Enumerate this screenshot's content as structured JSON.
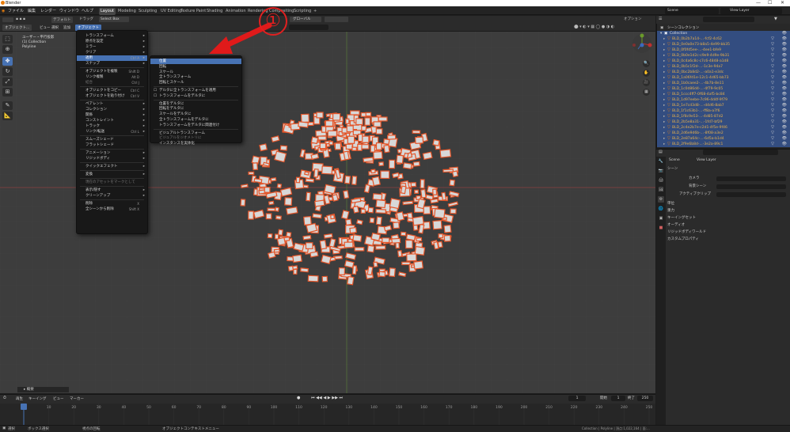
{
  "window": {
    "title": "Blender",
    "controls": [
      "—",
      "☐",
      "✕"
    ]
  },
  "menubar": {
    "menus": [
      "ファイル",
      "編集",
      "レンダー",
      "ウィンドウ",
      "ヘルプ"
    ],
    "workspaces": [
      "Layout",
      "Modeling",
      "Sculpting",
      "UV Editing",
      "Texture Paint",
      "Shading",
      "Animation",
      "Rendering",
      "Compositing",
      "Scripting",
      "+"
    ],
    "active_workspace": "Layout",
    "scene_label": "Scene",
    "viewlayer_label": "View Layer"
  },
  "viewport_header": {
    "mode": "オブジェクト...",
    "menus": [
      "ビュー",
      "選択",
      "追加",
      "オブジェクト"
    ],
    "orientation": "グローバル",
    "transform_label": "デフォルト",
    "drag_label": "ドラッグ",
    "select_box": "Select Box",
    "options_label": "オプション"
  },
  "viewport_info": {
    "line1": "ユーザー・平行投影",
    "line2": "(1) Collection",
    "line3": "Polyline"
  },
  "object_menu": {
    "items": [
      {
        "label": "トランスフォーム",
        "arrow": true
      },
      {
        "label": "原点を設定",
        "arrow": true
      },
      {
        "label": "ミラー",
        "arrow": true
      },
      {
        "label": "クリア",
        "arrow": true
      },
      {
        "label": "適用",
        "shortcut": "Ctrl A",
        "arrow": true,
        "highlight": true
      },
      {
        "label": "スナップ",
        "arrow": true
      },
      {
        "sep": true
      },
      {
        "label": "オブジェクトを複製",
        "shortcut": "Shift D"
      },
      {
        "label": "リンク複製",
        "shortcut": "Alt D"
      },
      {
        "label": "結合",
        "shortcut": "Ctrl J",
        "dim": true
      },
      {
        "sep": true
      },
      {
        "label": "オブジェクトをコピー",
        "shortcut": "Ctrl C"
      },
      {
        "label": "オブジェクトを貼り付け",
        "shortcut": "Ctrl V"
      },
      {
        "sep": true
      },
      {
        "label": "ペアレント",
        "arrow": true
      },
      {
        "label": "コレクション",
        "arrow": true
      },
      {
        "label": "関係",
        "arrow": true
      },
      {
        "label": "コンストレイント",
        "arrow": true
      },
      {
        "label": "トラック",
        "arrow": true
      },
      {
        "label": "リンク/転送",
        "shortcut": "Ctrl L",
        "arrow": true
      },
      {
        "sep": true
      },
      {
        "label": "スムーズシェード"
      },
      {
        "label": "フラットシェード"
      },
      {
        "sep": true
      },
      {
        "label": "アニメーション",
        "arrow": true
      },
      {
        "label": "リジッドボディ",
        "arrow": true
      },
      {
        "sep": true
      },
      {
        "label": "クイックエフェクト",
        "arrow": true
      },
      {
        "sep": true
      },
      {
        "label": "変換",
        "arrow": true
      },
      {
        "sep": true
      },
      {
        "label": "現在のアセットをマークとして",
        "dim": true
      },
      {
        "sep": true
      },
      {
        "label": "表示/隠す",
        "arrow": true
      },
      {
        "label": "クリーンアップ",
        "arrow": true
      },
      {
        "sep": true
      },
      {
        "label": "削除",
        "shortcut": "X"
      },
      {
        "label": "全シーンから削除",
        "shortcut": "Shift X"
      }
    ]
  },
  "apply_submenu": {
    "items": [
      {
        "label": "位置",
        "highlight": true
      },
      {
        "label": "回転"
      },
      {
        "label": "スケール"
      },
      {
        "label": "全トランスフォーム"
      },
      {
        "label": "回転とスケール"
      },
      {
        "sep": true
      },
      {
        "label": "デルタに全トランスフォームを適用",
        "icon": "☐"
      },
      {
        "label": "トランスフォームをデルタに",
        "icon": "☐"
      },
      {
        "sep": true
      },
      {
        "label": "位置をデルタに"
      },
      {
        "label": "回転をデルタに"
      },
      {
        "label": "スケールをデルタに"
      },
      {
        "label": "全トランスフォームをデルタに"
      },
      {
        "label": "トランスフォームをデルタに関連付け"
      },
      {
        "sep": true
      },
      {
        "label": "ビジュアルトランスフォーム"
      },
      {
        "label": "ビジュアルをジオメトリに",
        "dim": true
      },
      {
        "label": "インスタンスを実体化"
      }
    ]
  },
  "annotation": {
    "circle_number": "①",
    "arrow_color": "#e02020"
  },
  "navigation": {
    "x": "X",
    "y": "Y",
    "z": "Z"
  },
  "timeline": {
    "menus": [
      "再生",
      "キーイング",
      "ビュー",
      "マーカー"
    ],
    "current_frame": "1",
    "start_label": "開始",
    "start": "1",
    "end_label": "終了",
    "end": "250",
    "ticks": [
      "0",
      "10",
      "20",
      "30",
      "40",
      "50",
      "60",
      "70",
      "80",
      "90",
      "100",
      "110",
      "120",
      "130",
      "140",
      "150",
      "160",
      "170",
      "180",
      "190",
      "200",
      "210",
      "220",
      "230",
      "240",
      "250"
    ],
    "summary_label": "▸ 概要"
  },
  "statusbar": {
    "left1": "選択",
    "left2": "ボックス選択",
    "mid1": "視点の回転",
    "mid2": "オブジェクトコンテキストメニュー",
    "right": "Collection | Polyline | 頂点:1,022,164 | 面:..."
  },
  "outliner": {
    "title": "シーンコレクション",
    "collection": "Collection",
    "rows": [
      "BLD_0b2b7a14-...-fcf2-4c62",
      "BLD_0e0a0e73-b8a5-4e99-bb35",
      "BLD_0f0fd5ee-...-4ee1-bfe9",
      "BLD_0b0e1d2c-c9e9-4d9e-9b31",
      "BLD_0c4a6c8c-c7c6-4848-a1d8",
      "BLD_0b5c1f2d-...-1c3e-94a7",
      "BLD_0bc2b8d2-...-a0a1-e3dc",
      "BLD_1a06fd1e-12c1-4d65-bb73",
      "BLD_1b0caee2-...-4b7b-8e11",
      "BLD_1c0d86d4-...-4f79-9c05",
      "BLD_1ccc4ff7-0f68-4af5-bc84",
      "BLD_1d97eebe-7c96-4d4f-9f79",
      "BLD_1e7cd3d8-...-d4d6-8ab7",
      "BLD_1f1c63b1-...-ff8a-a7f6",
      "BLD_1f8c9e53-...-4d85-87d2",
      "BLD_2b5e8a31-...-1fd7-bf29",
      "BLD_2c4e2b7e-c2d1-4f5e-9f46",
      "BLD_2d6e9d6b-...-8f08-a3e2",
      "BLD_2e87a64c-...-6d5a-b1d4",
      "BLD_2f9e6b8d-...-3e2a-89c1"
    ]
  },
  "properties": {
    "scene_name": "Scene",
    "viewlayer": "View Layer",
    "section": "シーン",
    "camera_label": "カメラ",
    "bg_scene_label": "背景シーン",
    "active_clip_label": "アクティブクリップ",
    "panels": [
      "単位",
      "重力",
      "キーイングセット",
      "オーディオ",
      "リジッドボディワールド",
      "カスタムプロパティ"
    ]
  }
}
